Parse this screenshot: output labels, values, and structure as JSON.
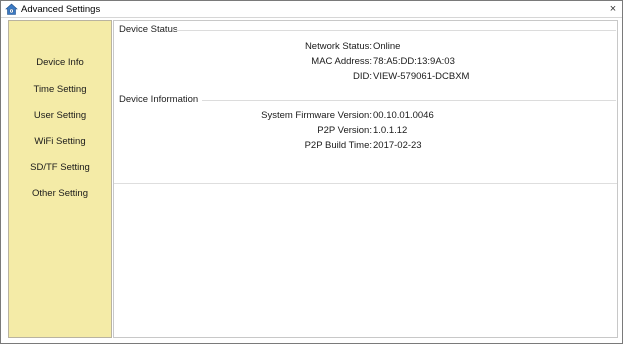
{
  "window": {
    "title": "Advanced Settings",
    "close_glyph": "×",
    "icon": "house-gear-icon"
  },
  "sidebar": {
    "items": [
      {
        "label": "Device Info"
      },
      {
        "label": "Time Setting"
      },
      {
        "label": "User Setting"
      },
      {
        "label": "WiFi Setting"
      },
      {
        "label": "SD/TF Setting"
      },
      {
        "label": "Other Setting"
      }
    ]
  },
  "device_status": {
    "title": "Device Status",
    "rows": [
      {
        "label": "Network Status:",
        "value": "Online"
      },
      {
        "label": "MAC Address:",
        "value": "78:A5:DD:13:9A:03"
      },
      {
        "label": "DID:",
        "value": "VIEW-579061-DCBXM"
      }
    ]
  },
  "device_information": {
    "title": "Device Information",
    "rows": [
      {
        "label": "System Firmware Version:",
        "value": "00.10.01.0046"
      },
      {
        "label": "P2P Version:",
        "value": "1.0.1.12"
      },
      {
        "label": "P2P Build Time:",
        "value": "2017-02-23"
      }
    ]
  },
  "colors": {
    "sidebar_bg": "#f4eba7",
    "icon_accent": "#2a6fb8"
  }
}
